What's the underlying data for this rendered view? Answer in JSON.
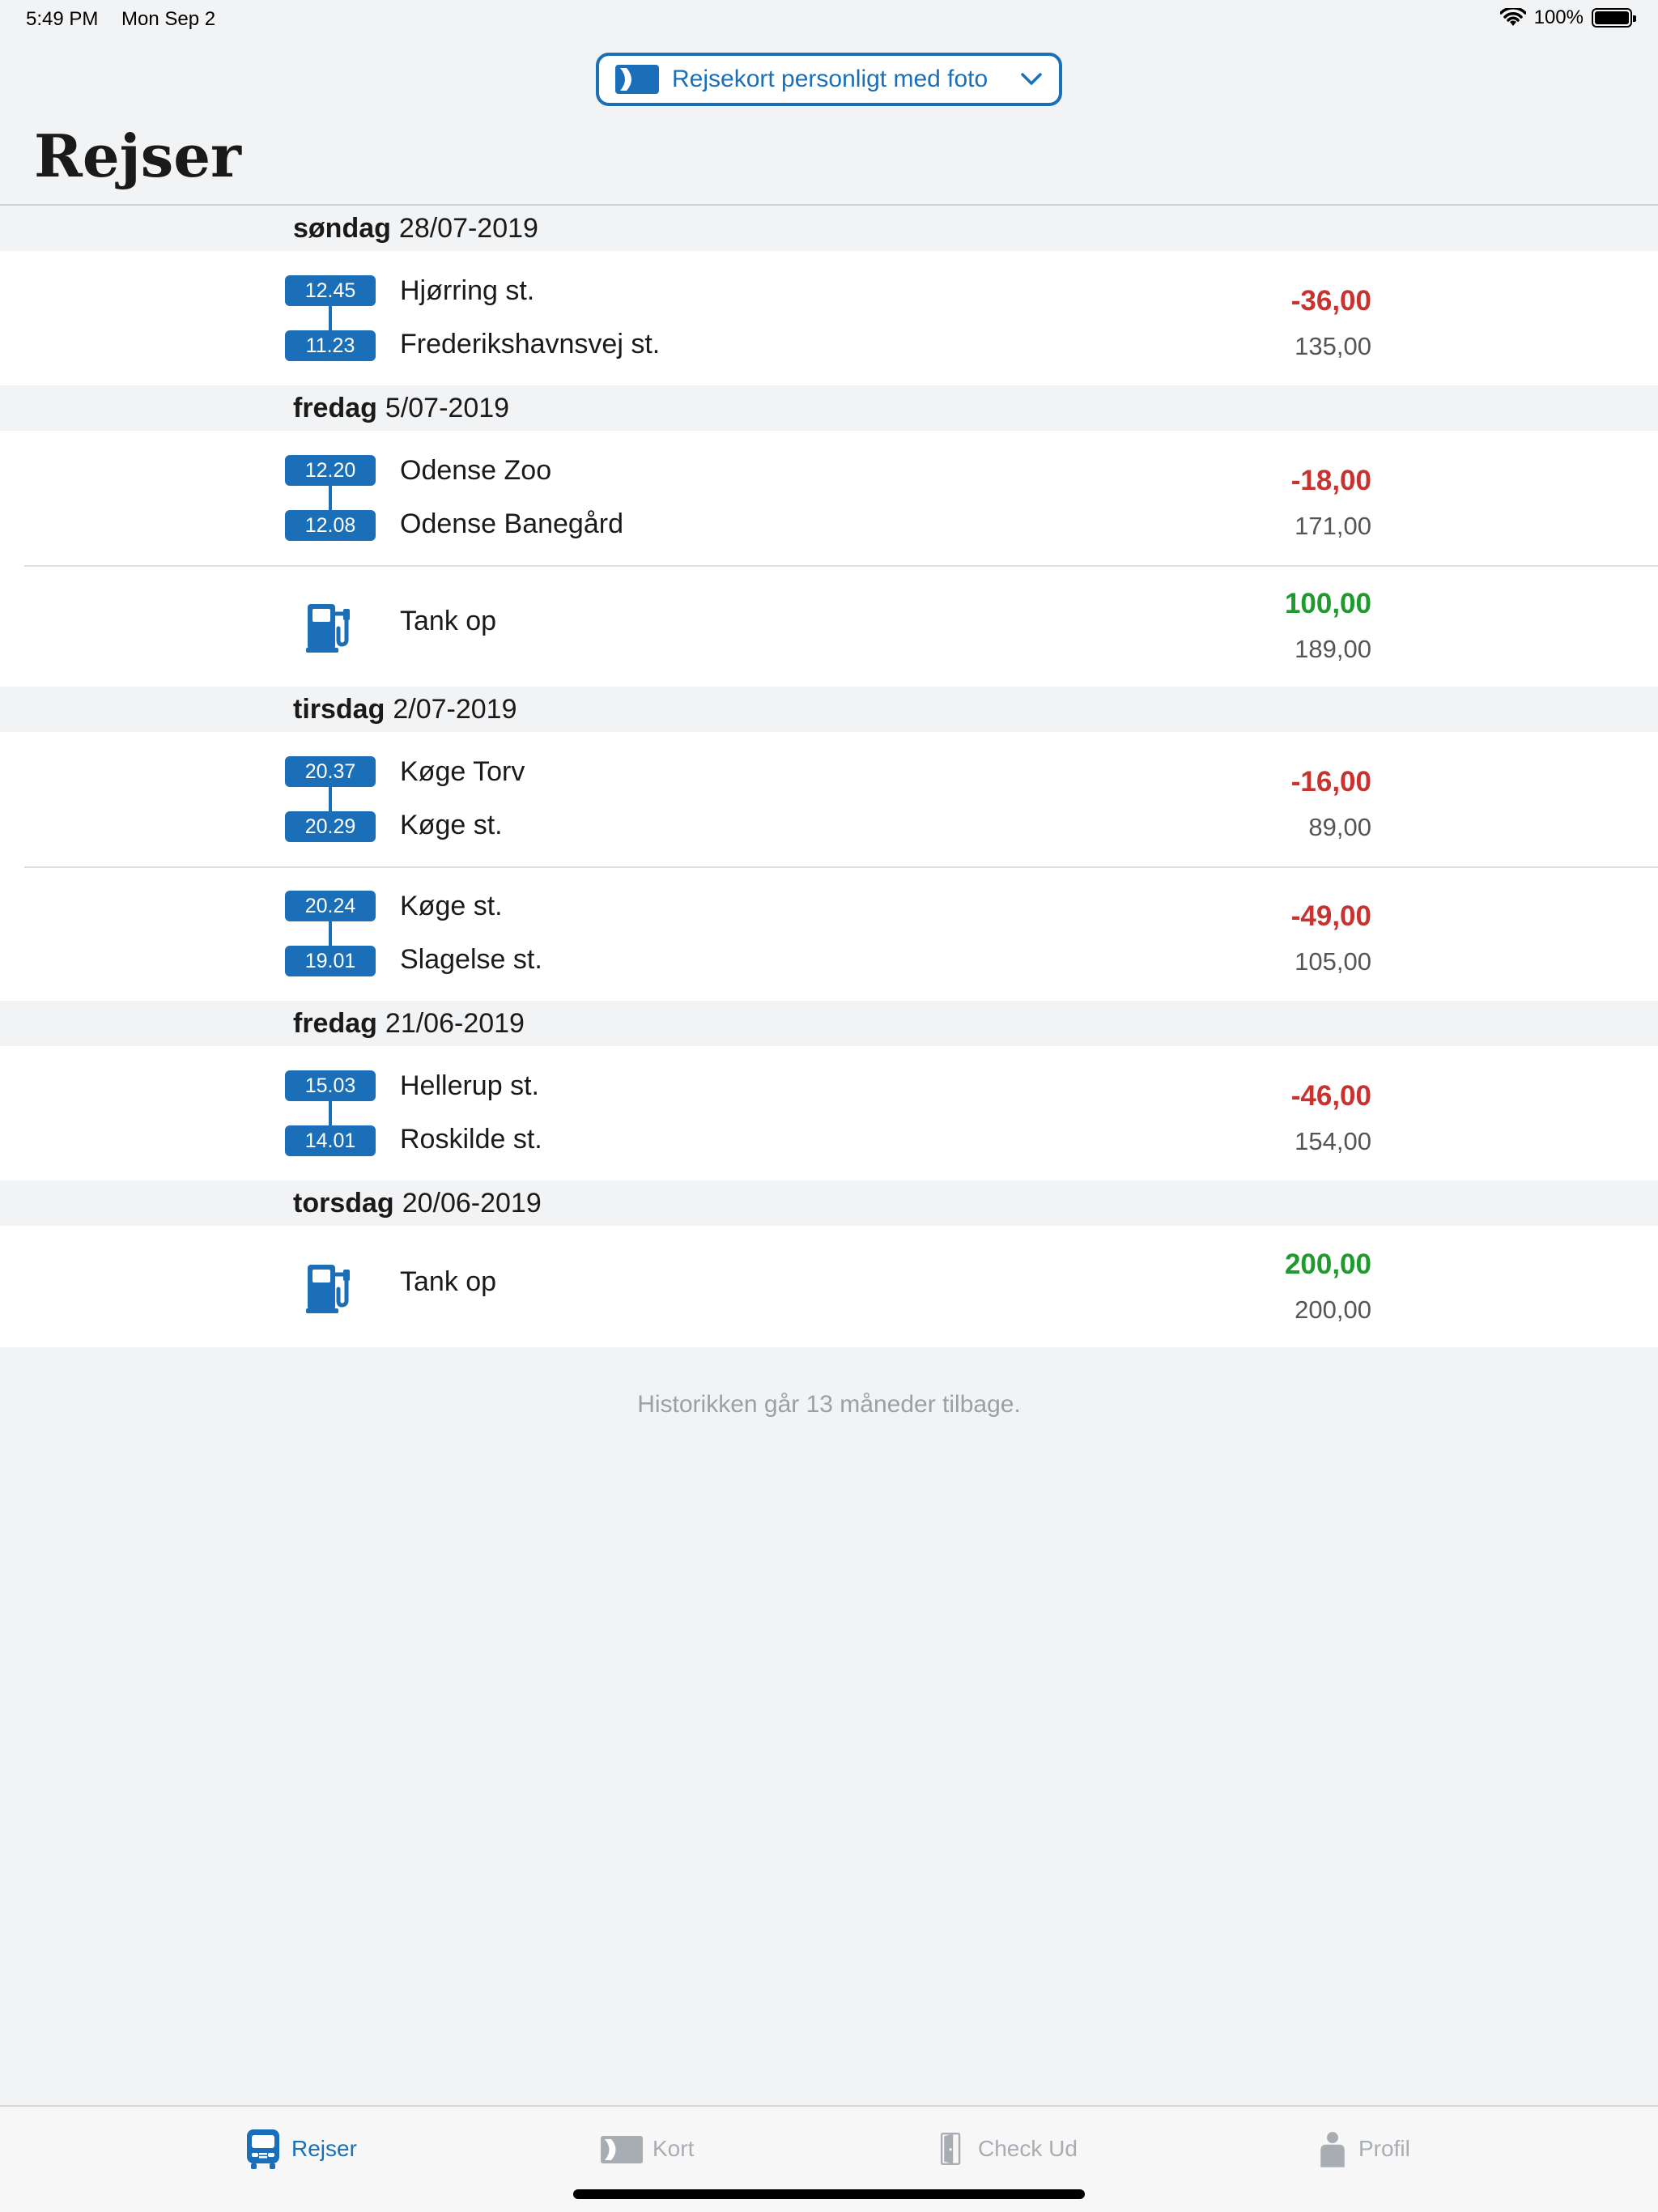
{
  "status_bar": {
    "time": "5:49 PM",
    "date": "Mon Sep 2",
    "battery": "100%"
  },
  "card_selector": {
    "label": "Rejsekort personligt med foto"
  },
  "page_title": "Rejser",
  "days": [
    {
      "weekday": "søndag",
      "date": "28/07-2019",
      "entries": [
        {
          "type": "trip",
          "start_time": "12.45",
          "start_stop": "Hjørring st.",
          "end_time": "11.23",
          "end_stop": "Frederikshavnsvej st.",
          "amount": "-36,00",
          "balance": "135,00"
        }
      ]
    },
    {
      "weekday": "fredag",
      "date": "5/07-2019",
      "entries": [
        {
          "type": "trip",
          "start_time": "12.20",
          "start_stop": "Odense Zoo",
          "end_time": "12.08",
          "end_stop": "Odense Banegård",
          "amount": "-18,00",
          "balance": "171,00"
        },
        {
          "type": "topup",
          "label": "Tank op",
          "amount": "100,00",
          "balance": "189,00"
        }
      ]
    },
    {
      "weekday": "tirsdag",
      "date": "2/07-2019",
      "entries": [
        {
          "type": "trip",
          "start_time": "20.37",
          "start_stop": "Køge Torv",
          "end_time": "20.29",
          "end_stop": "Køge st.",
          "amount": "-16,00",
          "balance": "89,00"
        },
        {
          "type": "trip",
          "start_time": "20.24",
          "start_stop": "Køge st.",
          "end_time": "19.01",
          "end_stop": "Slagelse st.",
          "amount": "-49,00",
          "balance": "105,00"
        }
      ]
    },
    {
      "weekday": "fredag",
      "date": "21/06-2019",
      "entries": [
        {
          "type": "trip",
          "start_time": "15.03",
          "start_stop": "Hellerup st.",
          "end_time": "14.01",
          "end_stop": "Roskilde st.",
          "amount": "-46,00",
          "balance": "154,00"
        }
      ]
    },
    {
      "weekday": "torsdag",
      "date": "20/06-2019",
      "entries": [
        {
          "type": "topup",
          "label": "Tank op",
          "amount": "200,00",
          "balance": "200,00"
        }
      ]
    }
  ],
  "footnote": "Historikken går 13 måneder tilbage.",
  "tabs": [
    {
      "label": "Rejser",
      "icon": "bus-icon",
      "active": true
    },
    {
      "label": "Kort",
      "icon": "card-icon",
      "active": false
    },
    {
      "label": "Check Ud",
      "icon": "door-icon",
      "active": false
    },
    {
      "label": "Profil",
      "icon": "person-icon",
      "active": false
    }
  ],
  "colors": {
    "accent": "#1a6fb8",
    "negative": "#c8322f",
    "positive": "#1e9a2e"
  }
}
